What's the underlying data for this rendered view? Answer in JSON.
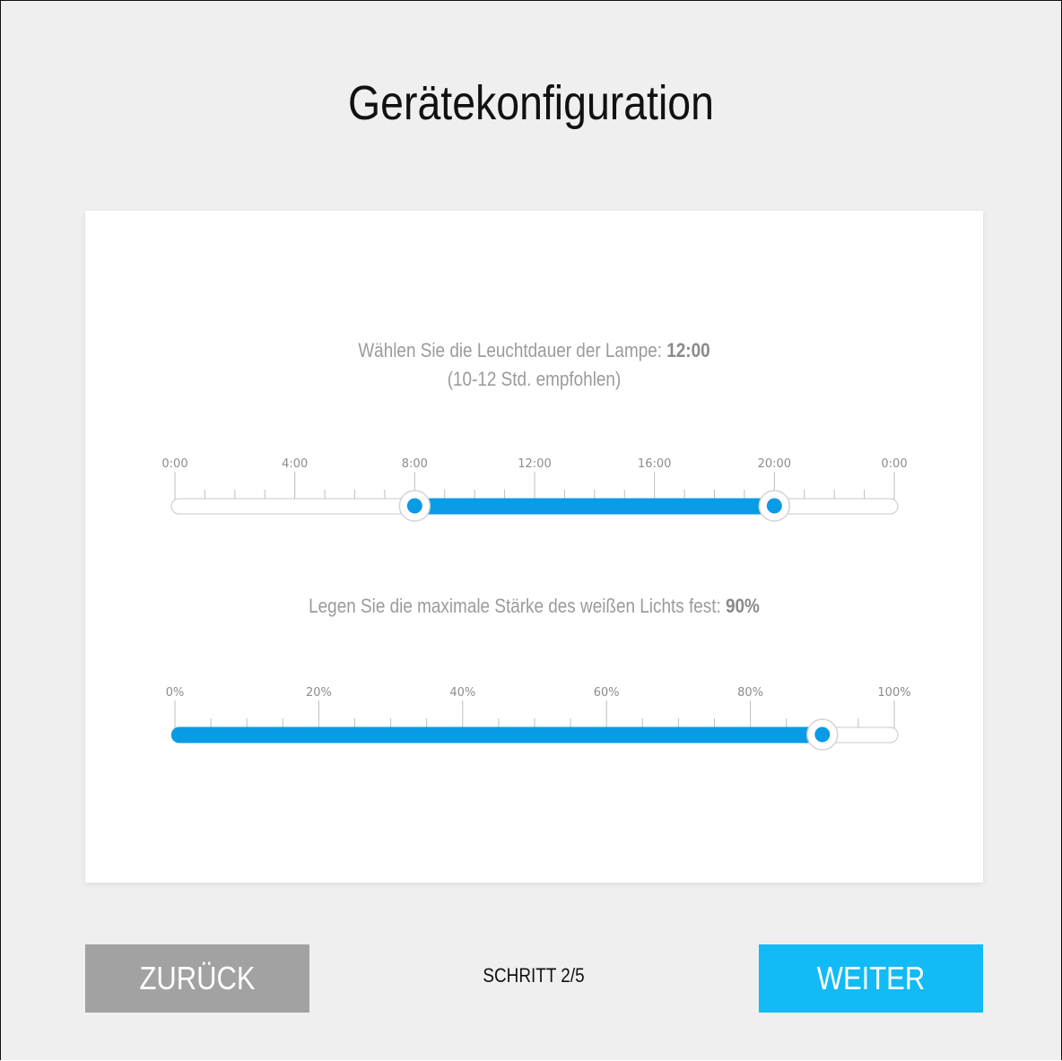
{
  "page": {
    "title": "Gerätekonfiguration"
  },
  "duration": {
    "label_prefix": "Wählen Sie die Leuchtdauer der Lampe: ",
    "value_text": "12:00",
    "hint": "(10-12 Std. empfohlen)",
    "tick_labels": [
      "0:00",
      "4:00",
      "8:00",
      "12:00",
      "16:00",
      "20:00",
      "0:00"
    ],
    "range_start_hours": 8,
    "range_end_hours": 20,
    "scale_max_hours": 24
  },
  "intensity": {
    "label_prefix": "Legen Sie die maximale Stärke des weißen Lichts fest: ",
    "value_text": "90%",
    "tick_labels": [
      "0%",
      "20%",
      "40%",
      "60%",
      "80%",
      "100%"
    ],
    "value_percent": 90
  },
  "footer": {
    "back_label": "ZURÜCK",
    "step_label": "SCHRITT 2/5",
    "next_label": "WEITER"
  },
  "colors": {
    "accent": "#0a9be6",
    "next_button": "#12bbf5",
    "back_button": "#a2a2a2",
    "background": "#efefef"
  }
}
